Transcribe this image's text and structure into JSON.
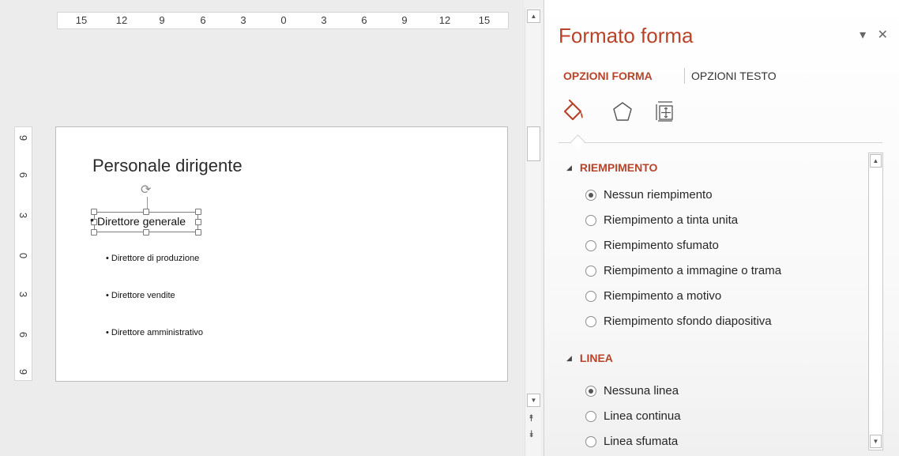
{
  "ruler": {
    "horizontal": [
      "15",
      "12",
      "9",
      "6",
      "3",
      "0",
      "3",
      "6",
      "9",
      "12",
      "15"
    ],
    "vertical": [
      "9",
      "6",
      "3",
      "0",
      "3",
      "6",
      "9"
    ]
  },
  "slide": {
    "title": "Personale dirigente",
    "selected_item": "Direttore generale",
    "bullet": "•",
    "sub_items": [
      "• Direttore di produzione",
      "• Direttore vendite",
      "• Direttore amministrativo"
    ]
  },
  "scrollbar": {
    "up": "▲",
    "down": "▼",
    "prev_slide": "⯭",
    "next_slide": "⯯"
  },
  "pane": {
    "title": "Formato forma",
    "pin": "▾",
    "close": "✕",
    "tabs": [
      "OPZIONI FORMA",
      "OPZIONI TESTO"
    ],
    "icons": [
      "fill-line-icon",
      "effects-icon",
      "size-properties-icon"
    ],
    "sections": {
      "fill": {
        "title": "RIEMPIMENTO",
        "options": [
          {
            "label": "Nessun riempimento",
            "selected": true
          },
          {
            "label": "Riempimento a tinta unita",
            "selected": false
          },
          {
            "label": "Riempimento sfumato",
            "selected": false
          },
          {
            "label": "Riempimento a immagine o trama",
            "selected": false
          },
          {
            "label": "Riempimento a motivo",
            "selected": false
          },
          {
            "label": "Riempimento sfondo diapositiva",
            "selected": false
          }
        ]
      },
      "line": {
        "title": "LINEA",
        "options": [
          {
            "label": "Nessuna linea",
            "selected": true
          },
          {
            "label": "Linea continua",
            "selected": false
          },
          {
            "label": "Linea sfumata",
            "selected": false
          }
        ]
      }
    }
  },
  "colors": {
    "accent": "#b8432a",
    "pane_bg": "#ffffff",
    "canvas_bg": "#ececec"
  }
}
